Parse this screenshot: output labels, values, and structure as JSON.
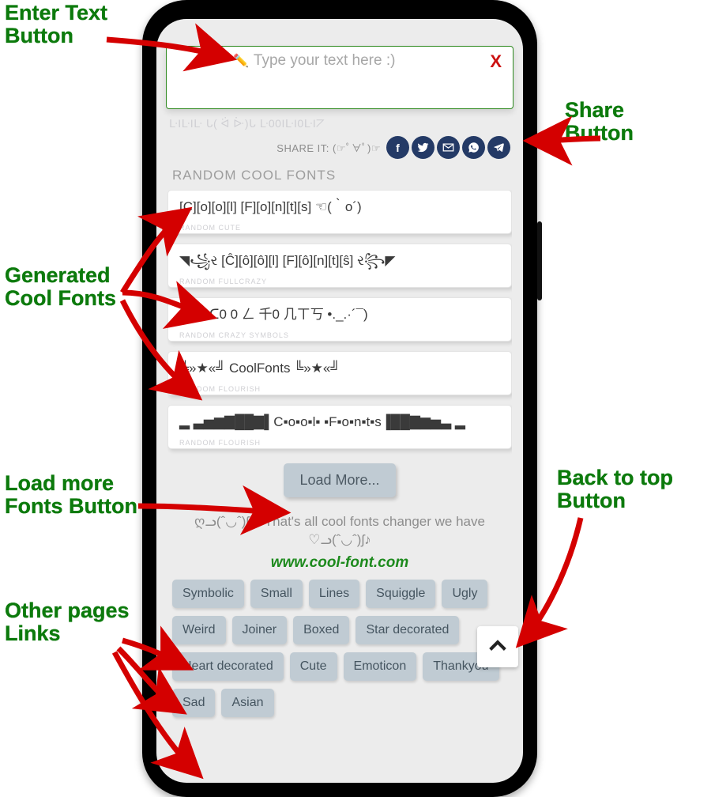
{
  "input": {
    "placeholder": "Type your text here :)",
    "clear": "X"
  },
  "birthday_faint": "ᒷIᒷIᒷ ᒐ( ᐛ ᐕ)ᒐ ᒷ00IᒷI0ᒷI⦢",
  "share": {
    "label": "SHARE IT: (☞ﾟ∀ﾟ)☞"
  },
  "section_title": "RANDOM COOL FONTS",
  "cards": [
    {
      "text": "[C][o][o][l] [F][o][n][t][s] ☜(｀o´)",
      "sub": "RANDOM CUTE"
    },
    {
      "text": "◥꧁ર [Ĉ][ô][ô][l] [F][ô][n][t][ŝ] ર꧂◤",
      "sub": "RANDOM FULLCRAZY"
    },
    {
      "text": "(‾̄ ‾̄)• ᑕ0 0 ㄥ 千0 几ㄒ丂 •._.·´¯)",
      "sub": "RANDOM CRAZY SYMBOLS"
    },
    {
      "text": "╚»★«╝  CoolFonts  ╚»★«╝",
      "sub": "RANDOM FLOURISH"
    },
    {
      "text": "▂ ▃▅▆▇██▇▌C▪o▪o▪l▪ ▪F▪o▪n▪t▪s▐██▇▆▅▃ ▂",
      "sub": "RANDOM FLOURISH"
    }
  ],
  "load_more": "Load More...",
  "end_text": "ღᓗ(ˆ◡ˆ)ʃ♡ That's all cool fonts changer we have ♡ᓗ(ˆ◡ˆ)ʃ♪",
  "site_url": "www.cool-font.com",
  "chips": [
    "Symbolic",
    "Small",
    "Lines",
    "Squiggle",
    "Ugly",
    "Weird",
    "Joiner",
    "Boxed",
    "Star decorated",
    "Heart decorated",
    "Cute",
    "Emoticon",
    "Thankyou",
    "Sad",
    "Asian"
  ],
  "annotations": {
    "enter_text": "Enter Text\nButton",
    "share_btn": "Share\nButton",
    "generated": "Generated\nCool Fonts",
    "load_more": "Load more\nFonts Button",
    "back_top": "Back to top\nButton",
    "other_links": "Other pages\nLinks"
  }
}
